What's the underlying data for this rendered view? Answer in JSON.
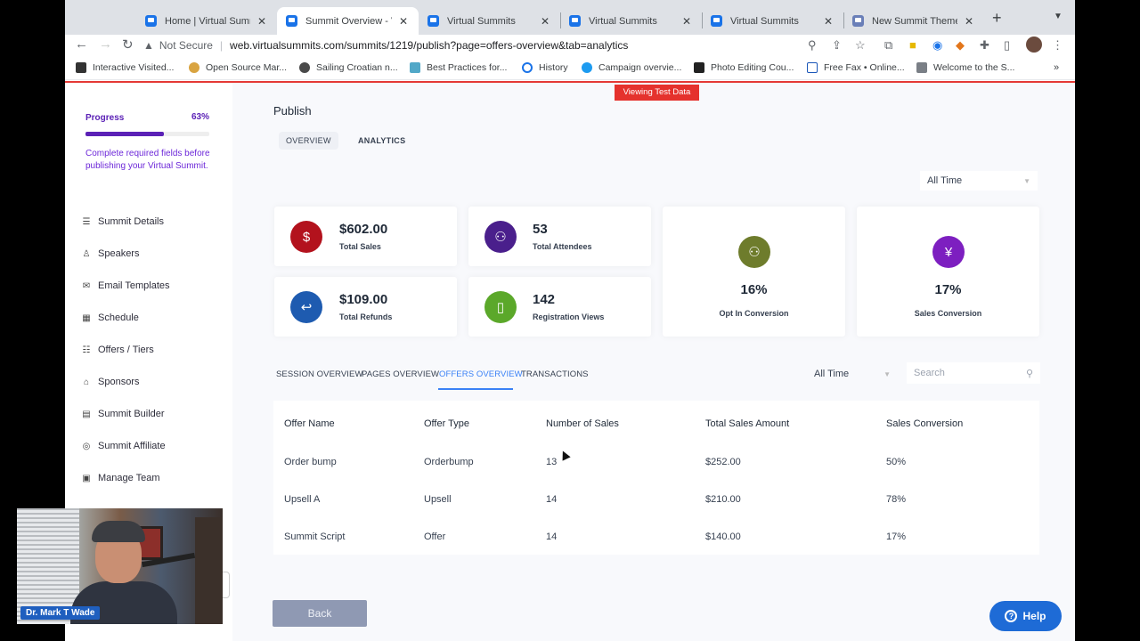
{
  "browser": {
    "tabs": [
      {
        "label": "Home | Virtual Summit",
        "favicon": "summit-favicon"
      },
      {
        "label": "Summit Overview - Vi",
        "favicon": "summit-favicon",
        "active": true
      },
      {
        "label": "Virtual Summits",
        "favicon": "summit-favicon"
      },
      {
        "label": "Virtual Summits",
        "favicon": "summit-favicon"
      },
      {
        "label": "Virtual Summits",
        "favicon": "summit-favicon"
      },
      {
        "label": "New Summit Themes",
        "favicon": "theme-favicon"
      }
    ],
    "security": "Not Secure",
    "url": "web.virtualsummits.com/summits/1219/publish?page=offers-overview&tab=analytics",
    "bookmarks": [
      "Interactive Visited...",
      "Open Source Mar...",
      "Sailing Croatian n...",
      "Best Practices for...",
      "History",
      "Campaign overvie...",
      "Photo Editing Cou...",
      "Free Fax • Online...",
      "Welcome to the S..."
    ]
  },
  "banner": {
    "test_data": "Viewing Test Data"
  },
  "sidebar": {
    "progress_label": "Progress",
    "progress_pct": "63%",
    "progress_fraction": 0.63,
    "progress_note": "Complete required fields before publishing your Virtual Summit.",
    "items": [
      {
        "label": "Summit Details",
        "icon": "list-icon"
      },
      {
        "label": "Speakers",
        "icon": "person-icon"
      },
      {
        "label": "Email Templates",
        "icon": "mail-icon"
      },
      {
        "label": "Schedule",
        "icon": "calendar-icon"
      },
      {
        "label": "Offers / Tiers",
        "icon": "tiers-icon"
      },
      {
        "label": "Sponsors",
        "icon": "bank-icon"
      },
      {
        "label": "Summit Builder",
        "icon": "builder-icon"
      },
      {
        "label": "Summit Affiliate",
        "icon": "affiliate-icon"
      },
      {
        "label": "Manage Team",
        "icon": "team-icon"
      }
    ]
  },
  "main": {
    "title": "Publish",
    "tabs": [
      "OVERVIEW",
      "ANALYTICS"
    ],
    "range": "All Time",
    "stats": [
      {
        "value": "$602.00",
        "label": "Total Sales",
        "icon": "dollar-icon",
        "color": "#b3121d"
      },
      {
        "value": "53",
        "label": "Total Attendees",
        "icon": "attendees-icon",
        "color": "#4a1f8c"
      },
      {
        "value": "$109.00",
        "label": "Total Refunds",
        "icon": "refund-icon",
        "color": "#1e5bb0"
      },
      {
        "value": "142",
        "label": "Registration Views",
        "icon": "document-icon",
        "color": "#5ba82a"
      },
      {
        "value": "16%",
        "label": "Opt In Conversion",
        "icon": "optin-icon",
        "color": "#6e7c2c"
      },
      {
        "value": "17%",
        "label": "Sales Conversion",
        "icon": "sales-conversion-icon",
        "color": "#7d1fc0"
      }
    ],
    "subtabs": [
      "SESSION OVERVIEW",
      "PAGES OVERVIEW",
      "OFFERS OVERVIEW",
      "TRANSACTIONS"
    ],
    "filter_range": "All Time",
    "search_placeholder": "Search",
    "table": {
      "headers": [
        "Offer Name",
        "Offer Type",
        "Number of Sales",
        "Total Sales Amount",
        "Sales Conversion"
      ],
      "rows": [
        [
          "Order bump",
          "Orderbump",
          "13",
          "$252.00",
          "50%"
        ],
        [
          "Upsell A",
          "Upsell",
          "14",
          "$210.00",
          "78%"
        ],
        [
          "Summit Script",
          "Offer",
          "14",
          "$140.00",
          "17%"
        ]
      ]
    },
    "back_label": "Back",
    "help_label": "Help"
  },
  "webcam": {
    "name": "Dr. Mark T Wade"
  }
}
